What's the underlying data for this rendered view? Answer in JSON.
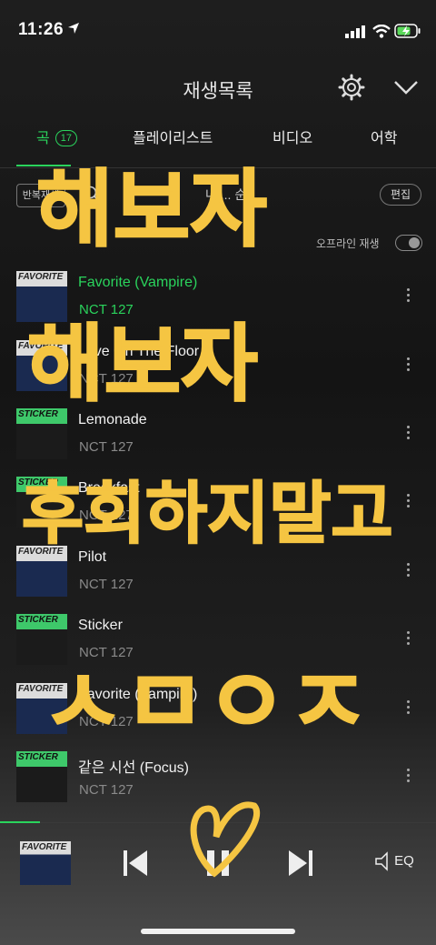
{
  "status": {
    "time": "11:26"
  },
  "header": {
    "title": "재생목록"
  },
  "tabs": [
    {
      "label": "곡",
      "count": "17"
    },
    {
      "label": "플레이리스트"
    },
    {
      "label": "비디오"
    },
    {
      "label": "어학"
    }
  ],
  "toolbar": {
    "repeat_label": "반복재생",
    "sort_label": "내 ... 순",
    "edit_label": "편집",
    "offline_label": "오프라인 재생"
  },
  "songs": [
    {
      "title": "Favorite (Vampire)",
      "artist": "NCT 127",
      "art": "FAVORITE",
      "playing": true
    },
    {
      "title": "Love On The Floor",
      "artist": "NCT 127",
      "art": "FAVORITE"
    },
    {
      "title": "Lemonade",
      "artist": "NCT 127",
      "art": "STICKER"
    },
    {
      "title": "Breakfast",
      "artist": "NCT 127",
      "art": "STICKER"
    },
    {
      "title": "Pilot",
      "artist": "NCT 127",
      "art": "FAVORITE"
    },
    {
      "title": "Sticker",
      "artist": "NCT 127",
      "art": "STICKER"
    },
    {
      "title": "Favorite (Vampire)",
      "artist": "NCT 127",
      "art": "FAVORITE"
    },
    {
      "title": "같은 시선 (Focus)",
      "artist": "NCT 127",
      "art": "STICKER"
    }
  ],
  "player": {
    "album_art": "FAVORITE",
    "eq_label": "EQ"
  },
  "handwriting": {
    "line1": "해보자",
    "line2": "해보자",
    "line3": "후회하지말고",
    "line4": "ㅅㅁㅇㅈ"
  },
  "colors": {
    "accent": "#2ad35c",
    "handwriting": "#f5c542"
  }
}
